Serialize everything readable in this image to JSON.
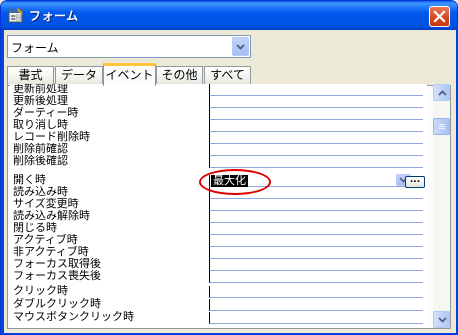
{
  "window": {
    "title": "フォーム",
    "icon": "form-app-icon"
  },
  "selector": {
    "value": "フォーム"
  },
  "tabs": [
    {
      "label": "書式",
      "active": false
    },
    {
      "label": "データ",
      "active": false
    },
    {
      "label": "イベント",
      "active": true
    },
    {
      "label": "その他",
      "active": false
    },
    {
      "label": "すべて",
      "active": false
    }
  ],
  "properties": [
    {
      "label": "更新前処理",
      "value": ""
    },
    {
      "label": "更新後処理",
      "value": ""
    },
    {
      "label": "ダーティー時",
      "value": ""
    },
    {
      "label": "取り消し時",
      "value": ""
    },
    {
      "label": "レコード削除時",
      "value": ""
    },
    {
      "label": "削除前確認",
      "value": ""
    },
    {
      "label": "削除後確認",
      "value": ""
    },
    {
      "label": "開く時",
      "value": "最大化"
    },
    {
      "label": "読み込み時",
      "value": ""
    },
    {
      "label": "サイズ変更時",
      "value": ""
    },
    {
      "label": "読み込み解除時",
      "value": ""
    },
    {
      "label": "閉じる時",
      "value": ""
    },
    {
      "label": "アクティブ時",
      "value": ""
    },
    {
      "label": "非アクティブ時",
      "value": ""
    },
    {
      "label": "フォーカス取得後",
      "value": ""
    },
    {
      "label": "フォーカス喪失後",
      "value": ""
    },
    {
      "label": "クリック時",
      "value": ""
    },
    {
      "label": "ダブルクリック時",
      "value": ""
    },
    {
      "label": "マウスボタンクリック時",
      "value": ""
    }
  ],
  "builder_button": {
    "label": "..."
  },
  "colors": {
    "title_bar": "#0058EE",
    "highlight_oval": "#E00000",
    "active_tab_accent": "#FFC83C"
  }
}
